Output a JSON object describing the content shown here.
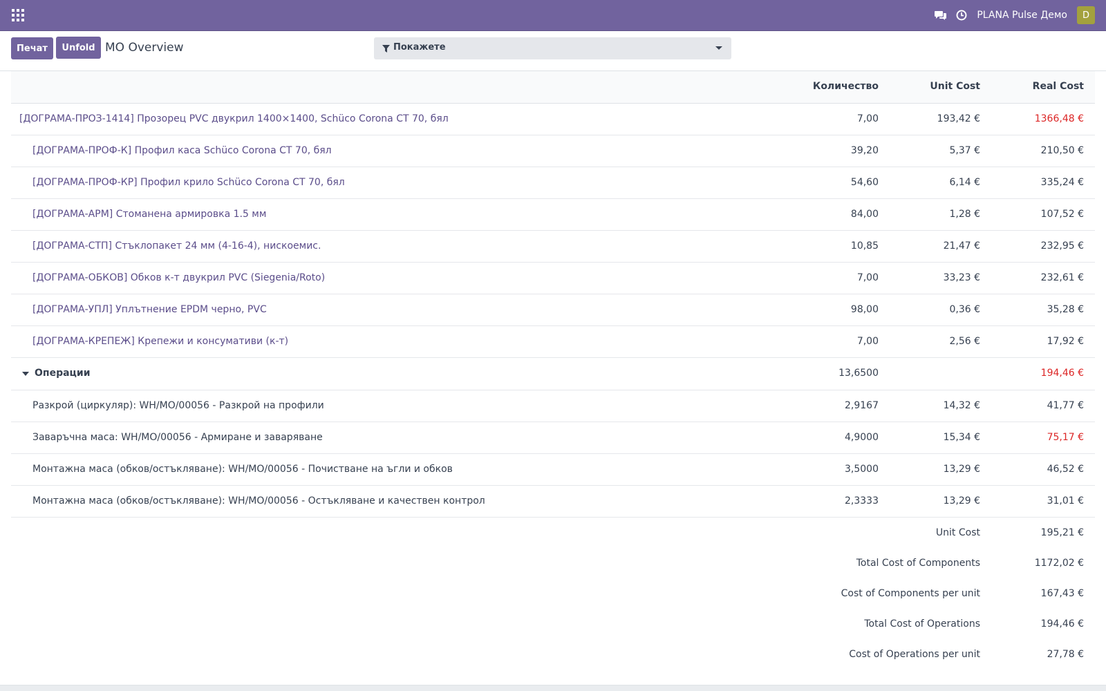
{
  "navbar": {
    "apps_icon": "grid-icon",
    "chat_icon": "chat-icon",
    "activity_icon": "clock-icon",
    "company": "PLANA Pulse Демо",
    "avatar_initial": "D",
    "color": "#71639e"
  },
  "controls": {
    "print_label": "Печат",
    "unfold_label": "Unfold",
    "breadcrumb": "MO Overview",
    "filter_label": "Покажете"
  },
  "table": {
    "headers": {
      "name": "",
      "qty": "Количество",
      "unit_cost": "Unit Cost",
      "real_cost": "Real Cost"
    },
    "product": {
      "name": "[ДОГРАМА-ПРОЗ-1414] Прозорец PVC двукрил 1400×1400, Schüco Corona CT 70, бял",
      "qty": "7,00",
      "unit_cost": "193,42 €",
      "real_cost": "1366,48 €"
    },
    "components": [
      {
        "name": "[ДОГРАМА-ПРОФ-К] Профил каса Schüco Corona CT 70, бял",
        "qty": "39,20",
        "unit_cost": "5,37 €",
        "real_cost": "210,50 €"
      },
      {
        "name": "[ДОГРАМА-ПРОФ-КР] Профил крило Schüco Corona CT 70, бял",
        "qty": "54,60",
        "unit_cost": "6,14 €",
        "real_cost": "335,24 €"
      },
      {
        "name": "[ДОГРАМА-АРМ] Стоманена армировка 1.5 мм",
        "qty": "84,00",
        "unit_cost": "1,28 €",
        "real_cost": "107,52 €"
      },
      {
        "name": "[ДОГРАМА-СТП] Стъклопакет 24 мм (4-16-4), нискоемис.",
        "qty": "10,85",
        "unit_cost": "21,47 €",
        "real_cost": "232,95 €"
      },
      {
        "name": "[ДОГРАМА-ОБКОВ] Обков к-т двукрил PVC (Siegenia/Roto)",
        "qty": "7,00",
        "unit_cost": "33,23 €",
        "real_cost": "232,61 €"
      },
      {
        "name": "[ДОГРАМА-УПЛ] Уплътнение EPDM черно, PVC",
        "qty": "98,00",
        "unit_cost": "0,36 €",
        "real_cost": "35,28 €"
      },
      {
        "name": "[ДОГРАМА-КРЕПЕЖ] Крепежи и консумативи (к-т)",
        "qty": "7,00",
        "unit_cost": "2,56 €",
        "real_cost": "17,92 €"
      }
    ],
    "operations_header": {
      "label": "Операции",
      "qty": "13,6500",
      "real_cost": "194,46 €"
    },
    "operations": [
      {
        "name": "Разкрой (циркуляр): WH/MO/00056 - Разкрой на профили",
        "qty": "2,9167",
        "unit_cost": "14,32 €",
        "real_cost": "41,77 €",
        "red": false
      },
      {
        "name": "Заваръчна маса: WH/MO/00056 - Армиране и заваряване",
        "qty": "4,9000",
        "unit_cost": "15,34 €",
        "real_cost": "75,17 €",
        "red": true
      },
      {
        "name": "Монтажна маса (обков/остъкляване): WH/MO/00056 - Почистване на ъгли и обков",
        "qty": "3,5000",
        "unit_cost": "13,29 €",
        "real_cost": "46,52 €",
        "red": false
      },
      {
        "name": "Монтажна маса (обков/остъкляване): WH/MO/00056 - Остъкляване и качествен контрол",
        "qty": "2,3333",
        "unit_cost": "13,29 €",
        "real_cost": "31,01 €",
        "red": false
      }
    ],
    "summary": [
      {
        "label": "Unit Cost",
        "value": "195,21 €"
      },
      {
        "label": "Total Cost of Components",
        "value": "1172,02 €"
      },
      {
        "label": "Cost of Components per unit",
        "value": "167,43 €"
      },
      {
        "label": "Total Cost of Operations",
        "value": "194,46 €"
      },
      {
        "label": "Cost of Operations per unit",
        "value": "27,78 €"
      }
    ],
    "over_budget_color": "#dc2626",
    "link_color": "#5b4d8a"
  }
}
